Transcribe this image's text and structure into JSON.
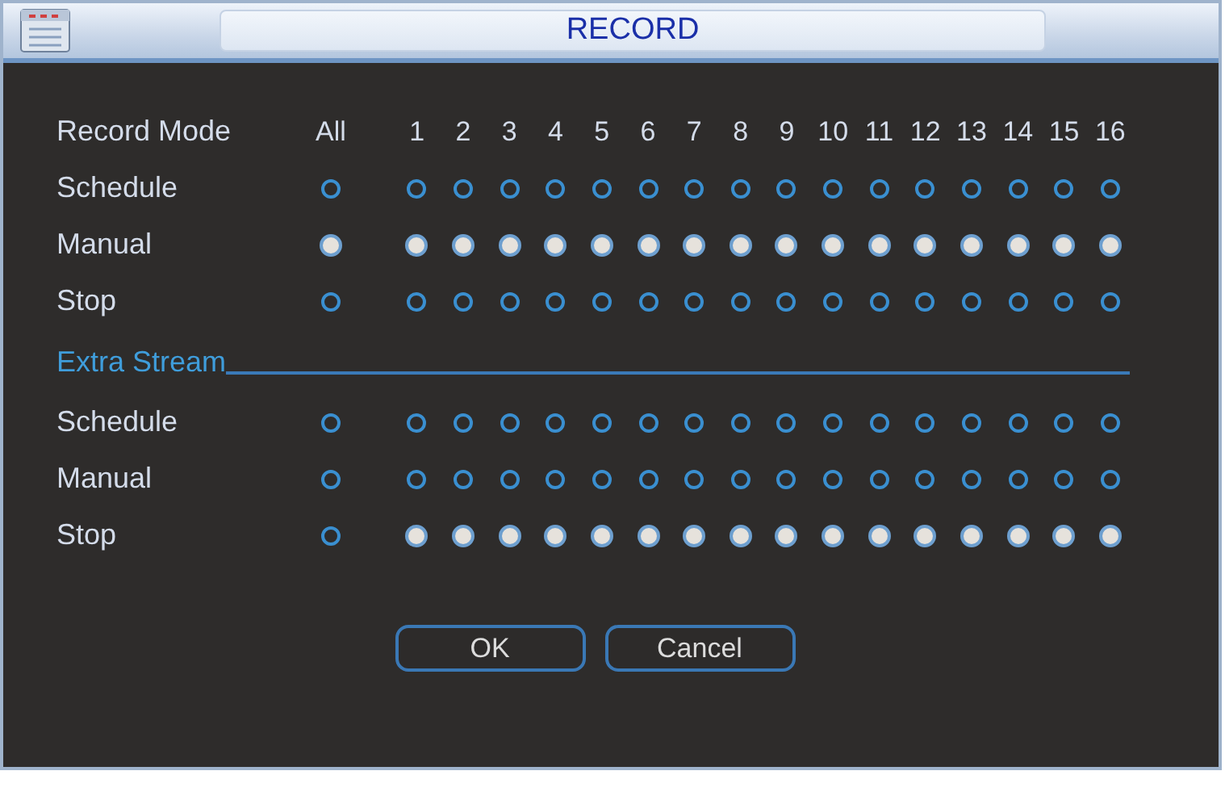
{
  "window": {
    "title": "RECORD"
  },
  "header": {
    "label": "Record Mode",
    "all": "All",
    "channels": [
      "1",
      "2",
      "3",
      "4",
      "5",
      "6",
      "7",
      "8",
      "9",
      "10",
      "11",
      "12",
      "13",
      "14",
      "15",
      "16"
    ]
  },
  "main_stream": {
    "rows": [
      {
        "label": "Schedule",
        "all": {
          "selected": false
        },
        "channels": [
          {
            "selected": false
          },
          {
            "selected": false
          },
          {
            "selected": false
          },
          {
            "selected": false
          },
          {
            "selected": false
          },
          {
            "selected": false
          },
          {
            "selected": false
          },
          {
            "selected": false
          },
          {
            "selected": false
          },
          {
            "selected": false
          },
          {
            "selected": false
          },
          {
            "selected": false
          },
          {
            "selected": false
          },
          {
            "selected": false
          },
          {
            "selected": false
          },
          {
            "selected": false
          }
        ]
      },
      {
        "label": "Manual",
        "all": {
          "selected": true
        },
        "channels": [
          {
            "selected": true
          },
          {
            "selected": true
          },
          {
            "selected": true
          },
          {
            "selected": true
          },
          {
            "selected": true
          },
          {
            "selected": true
          },
          {
            "selected": true
          },
          {
            "selected": true
          },
          {
            "selected": true
          },
          {
            "selected": true
          },
          {
            "selected": true
          },
          {
            "selected": true
          },
          {
            "selected": true
          },
          {
            "selected": true
          },
          {
            "selected": true
          },
          {
            "selected": true
          }
        ]
      },
      {
        "label": "Stop",
        "all": {
          "selected": false
        },
        "channels": [
          {
            "selected": false
          },
          {
            "selected": false
          },
          {
            "selected": false
          },
          {
            "selected": false
          },
          {
            "selected": false
          },
          {
            "selected": false
          },
          {
            "selected": false
          },
          {
            "selected": false
          },
          {
            "selected": false
          },
          {
            "selected": false
          },
          {
            "selected": false
          },
          {
            "selected": false
          },
          {
            "selected": false
          },
          {
            "selected": false
          },
          {
            "selected": false
          },
          {
            "selected": false
          }
        ]
      }
    ]
  },
  "extra_stream": {
    "title": "Extra Stream",
    "rows": [
      {
        "label": "Schedule",
        "all": {
          "selected": false
        },
        "channels": [
          {
            "selected": false
          },
          {
            "selected": false
          },
          {
            "selected": false
          },
          {
            "selected": false
          },
          {
            "selected": false
          },
          {
            "selected": false
          },
          {
            "selected": false
          },
          {
            "selected": false
          },
          {
            "selected": false
          },
          {
            "selected": false
          },
          {
            "selected": false
          },
          {
            "selected": false
          },
          {
            "selected": false
          },
          {
            "selected": false
          },
          {
            "selected": false
          },
          {
            "selected": false
          }
        ]
      },
      {
        "label": "Manual",
        "all": {
          "selected": false
        },
        "channels": [
          {
            "selected": false
          },
          {
            "selected": false
          },
          {
            "selected": false
          },
          {
            "selected": false
          },
          {
            "selected": false
          },
          {
            "selected": false
          },
          {
            "selected": false
          },
          {
            "selected": false
          },
          {
            "selected": false
          },
          {
            "selected": false
          },
          {
            "selected": false
          },
          {
            "selected": false
          },
          {
            "selected": false
          },
          {
            "selected": false
          },
          {
            "selected": false
          },
          {
            "selected": false
          }
        ]
      },
      {
        "label": "Stop",
        "all": {
          "selected": false
        },
        "channels": [
          {
            "selected": true
          },
          {
            "selected": true
          },
          {
            "selected": true
          },
          {
            "selected": true
          },
          {
            "selected": true
          },
          {
            "selected": true
          },
          {
            "selected": true
          },
          {
            "selected": true
          },
          {
            "selected": true
          },
          {
            "selected": true
          },
          {
            "selected": true
          },
          {
            "selected": true
          },
          {
            "selected": true
          },
          {
            "selected": true
          },
          {
            "selected": true
          },
          {
            "selected": true
          }
        ]
      }
    ]
  },
  "buttons": [
    "OK",
    "Cancel"
  ]
}
